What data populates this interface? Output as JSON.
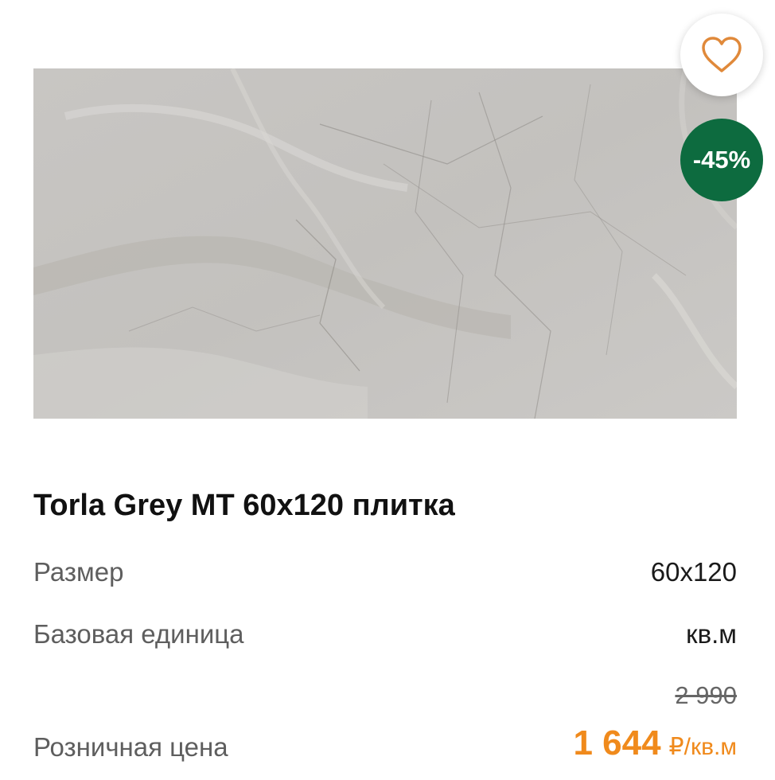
{
  "product": {
    "image_alt": "Torla Grey MT 60x120 плитка",
    "favorite_icon": "heart-icon",
    "discount_badge": "-45%",
    "title": "Torla Grey MT 60x120 плитка",
    "specs": [
      {
        "label": "Размер",
        "value": "60x120"
      },
      {
        "label": "Базовая единица",
        "value": "кв.м"
      }
    ],
    "price": {
      "label": "Розничная цена",
      "old": "2 990",
      "current": "1 644",
      "unit": "₽/кв.м"
    }
  },
  "colors": {
    "accent_price": "#f08a1c",
    "badge_green": "#0d6b3f",
    "heart_stroke": "#e0893a"
  }
}
